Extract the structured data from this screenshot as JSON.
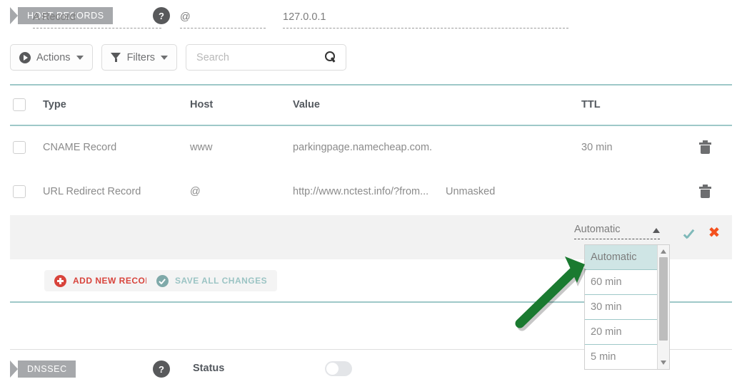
{
  "sections": {
    "host_records": {
      "tag": "HOST RECORDS",
      "help": "?"
    },
    "dnssec": {
      "tag": "DNSSEC",
      "help": "?",
      "status_label": "Status",
      "toggle_state": "off"
    }
  },
  "toolbar": {
    "actions_label": "Actions",
    "filters_label": "Filters",
    "search_value": "",
    "search_placeholder": "Search"
  },
  "table": {
    "headers": {
      "type": "Type",
      "host": "Host",
      "value": "Value",
      "ttl": "TTL"
    },
    "rows": [
      {
        "type": "CNAME Record",
        "host": "www",
        "value": "parkingpage.namecheap.com.",
        "extra": "",
        "ttl": "30 min"
      },
      {
        "type": "URL Redirect Record",
        "host": "@",
        "value": "http://www.nctest.info/?from...",
        "extra": "Unmasked",
        "ttl": ""
      }
    ]
  },
  "edit_row": {
    "type_value": "A Record",
    "host_value": "@",
    "value_value": "127.0.0.1",
    "ttl_value": "Automatic",
    "confirm_icon": "check-icon",
    "cancel_icon": "close-icon",
    "cancel_glyph": "✖"
  },
  "ttl_dropdown": {
    "options": [
      {
        "label": "Automatic",
        "selected": true
      },
      {
        "label": "60 min",
        "selected": false
      },
      {
        "label": "30 min",
        "selected": false
      },
      {
        "label": "20 min",
        "selected": false
      },
      {
        "label": "5 min",
        "selected": false
      }
    ]
  },
  "actions": {
    "add_new_record": "ADD NEW RECORD",
    "save_all_changes": "SAVE ALL CHANGES"
  },
  "colors": {
    "teal_rule": "#9ec8c8",
    "tag_gray": "#a6a8ab",
    "accent_red": "#d8443c",
    "accent_orange": "#f4511e",
    "save_teal": "#9bc4c4",
    "annotation_green": "#1a7a30"
  }
}
